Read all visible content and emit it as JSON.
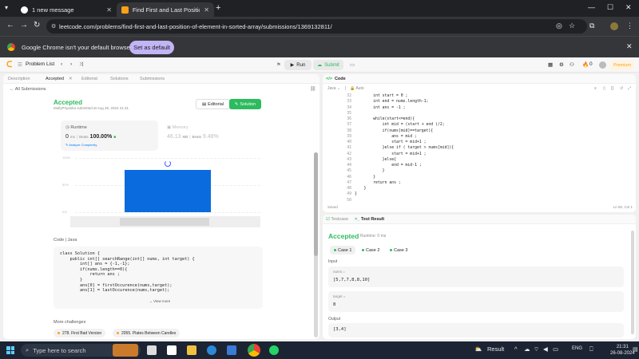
{
  "browser": {
    "tabs": [
      {
        "title": "1 new message",
        "active": false
      },
      {
        "title": "Find First and Last Position of E",
        "active": true
      }
    ],
    "url": "leetcode.com/problems/find-first-and-last-position-of-element-in-sorted-array/submissions/1369132811/",
    "default_bar": {
      "message": "Google Chrome isn't your default browser",
      "button": "Set as default"
    }
  },
  "lc_nav": {
    "problem_list": "Problem List",
    "run": "Run",
    "submit": "Submit",
    "counter": "0",
    "premium": "Premium"
  },
  "left_tabs": [
    "Description",
    "Accepted",
    "Editorial",
    "Solutions",
    "Submissions"
  ],
  "submission": {
    "back": "All Submissions",
    "status": "Accepted",
    "author": "MullyPriyanka submitted at Aug 26, 2024 21:31",
    "editorial_btn": "Editorial",
    "solution_btn": "Solution",
    "runtime": {
      "label": "Runtime",
      "value": "0",
      "unit": "ms",
      "beats_label": "Beats",
      "beats": "100.00%",
      "analyze": "Analyze Complexity"
    },
    "memory": {
      "label": "Memory",
      "value": "46.13",
      "unit": "MB",
      "beats_label": "Beats",
      "beats": "9.48%"
    },
    "code_lang": "Code  |  Java",
    "code_lines": [
      "class Solution {",
      "    public int[] searchRange(int[] nums, int target) {",
      "        int[] ans = {-1,-1};",
      "        if(nums.length==0){",
      "            return ans ;",
      "        }",
      "        ans[0] = firstOccurence(nums,target);",
      "        ans[1] = lastOccurence(nums,target);"
    ],
    "view_more": "View more",
    "more_challenges": "More challenges",
    "challenges": [
      "278. First Bad Version",
      "2055. Plates Between Candles"
    ]
  },
  "chart_data": {
    "type": "bar",
    "ytick_labels": [
      "100%",
      "50%",
      "0%"
    ],
    "ylim": [
      0,
      100
    ],
    "values": [
      100
    ]
  },
  "code_editor": {
    "tab": "Code",
    "language": "Java",
    "mode": "Auto",
    "start_line": 32,
    "lines": [
      "        int start = 0 ;",
      "        int end = nums.length-1;",
      "        int ans = -1 ;",
      "",
      "        while(start<=end){",
      "            int mid = (start + end )/2;",
      "            if(nums[mid]==target){",
      "                ans = mid ;",
      "                start = mid+1 ;",
      "            }else if ( target > nums[mid]){",
      "                start = mid+1 ;",
      "            }else{",
      "                end = mid-1 ;",
      "            }",
      "        }",
      "        return ans ;",
      "    }",
      "}",
      ""
    ],
    "saved": "Saved",
    "cursor": "Ln 50, Col 1"
  },
  "result": {
    "tabs": [
      "Testcase",
      "Test Result"
    ],
    "status": "Accepted",
    "runtime": "Runtime: 0 ms",
    "cases": [
      "Case 1",
      "Case 2",
      "Case 3"
    ],
    "input_label": "Input",
    "inputs": [
      {
        "name": "nums =",
        "value": "[5,7,7,8,8,10]"
      },
      {
        "name": "target =",
        "value": "8"
      }
    ],
    "output_label": "Output",
    "output": "[3,4]"
  },
  "taskbar": {
    "search_placeholder": "Type here to search",
    "weather": "Result",
    "lang": "ENG",
    "time": "21:31",
    "date": "26-08-2024"
  },
  "colors": {
    "accent_green": "#2cbb5d",
    "lc_orange": "#ffa116",
    "bar_blue": "#0a6bdf"
  }
}
